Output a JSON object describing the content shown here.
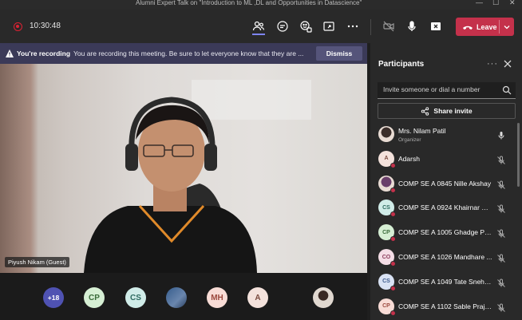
{
  "window": {
    "title": "Alumni Expert Talk on \"Introduction to ML ,DL and Opportunities in Datascience\""
  },
  "toolbar": {
    "timer": "10:30:48",
    "leave_label": "Leave"
  },
  "banner": {
    "bold": "You're recording",
    "message": "You are recording this meeting. Be sure to let everyone know that they are ...",
    "dismiss_label": "Dismiss"
  },
  "video": {
    "speaker_label": "Piyush Nikam (Guest)"
  },
  "strip": {
    "more_count": "+18",
    "avatars": [
      "CP",
      "CS",
      "MH",
      "A"
    ]
  },
  "panel": {
    "title": "Participants",
    "invite_placeholder": "Invite someone or dial a number",
    "share_label": "Share invite",
    "participants": [
      {
        "initials": "",
        "name": "Mrs. Nilam Patil",
        "role": "Organizer",
        "bg": "#3b2e2a",
        "fg": "#fff",
        "photo": true
      },
      {
        "initials": "A",
        "name": "Adarsh",
        "bg": "#f4e2dc",
        "fg": "#7a4a3e"
      },
      {
        "initials": "",
        "name": "COMP SE A 0845 Nille Akshay",
        "bg": "#6a3f6a",
        "fg": "#fff",
        "photo": true
      },
      {
        "initials": "CS",
        "name": "COMP SE A 0924 Khairnar Sa...",
        "bg": "#d0ece8",
        "fg": "#2e6b60"
      },
      {
        "initials": "CP",
        "name": "COMP SE A 1005 Ghadge Pra...",
        "bg": "#d6efd4",
        "fg": "#3a6b3a"
      },
      {
        "initials": "CO",
        "name": "COMP SE A 1026 Mandhare ...",
        "bg": "#f4dde6",
        "fg": "#8c3d5d"
      },
      {
        "initials": "CS",
        "name": "COMP SE A 1049 Tate Snehal...",
        "bg": "#d9e2f4",
        "fg": "#3d5a8c"
      },
      {
        "initials": "CP",
        "name": "COMP SE A 1102 Sable Prajwal",
        "bg": "#f8dcd6",
        "fg": "#9c4a3f"
      }
    ]
  }
}
